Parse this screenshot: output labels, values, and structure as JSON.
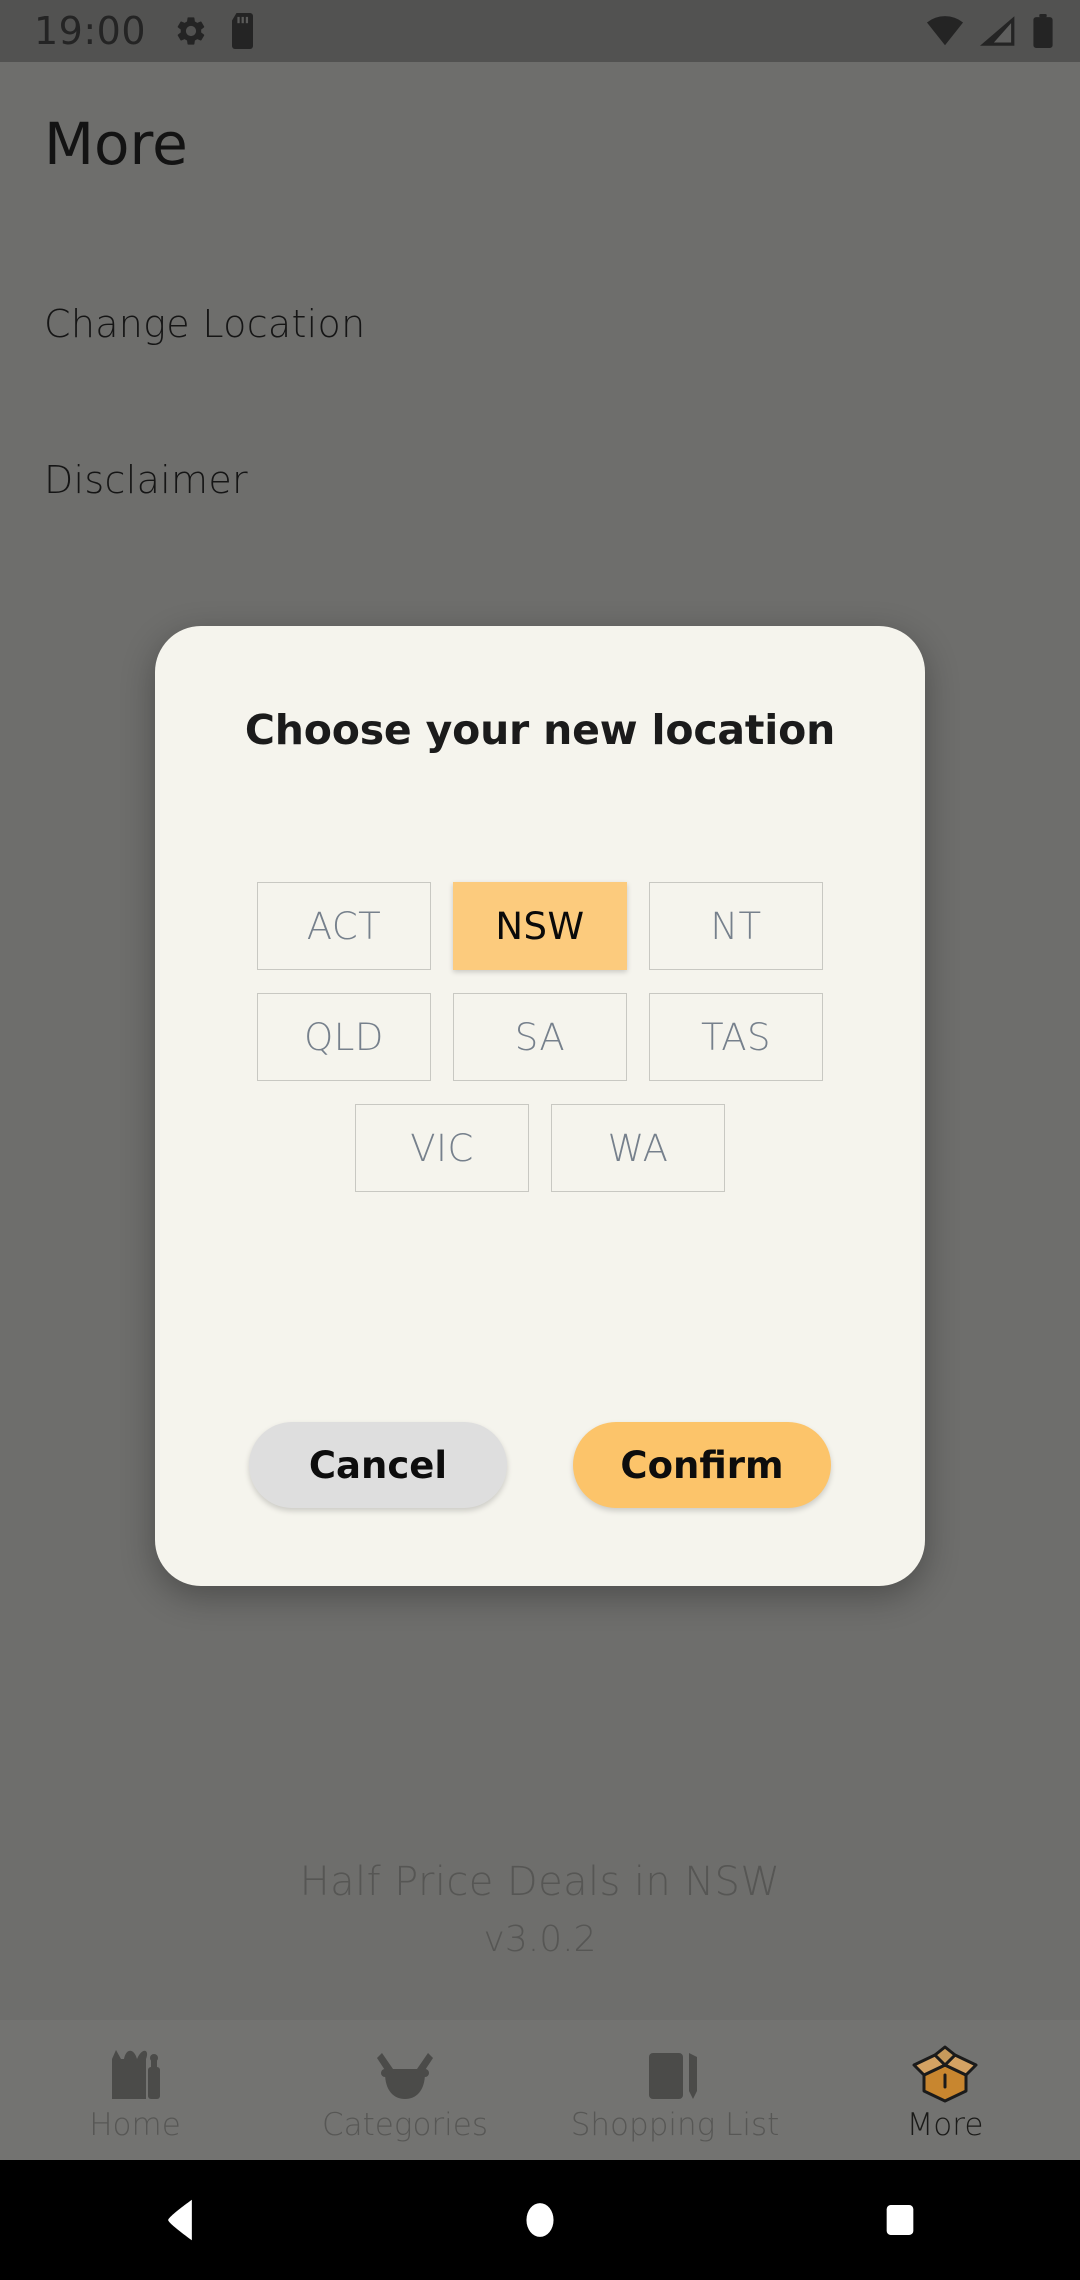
{
  "status_bar": {
    "time": "19:00",
    "left_icons": [
      "gear-icon",
      "sd-card-icon"
    ],
    "right_icons": [
      "wifi-icon",
      "cellular-signal-icon",
      "battery-icon"
    ],
    "background_color": "#525251"
  },
  "app": {
    "page_title": "More",
    "menu_items": [
      {
        "label": "Change Location"
      },
      {
        "label": "Disclaimer"
      }
    ],
    "footer": {
      "line1": "Half Price Deals in NSW",
      "line2": "v3.0.2"
    },
    "tabs": [
      {
        "label": "Home",
        "icon": "grocery-bag-icon",
        "active": false
      },
      {
        "label": "Categories",
        "icon": "mortar-pestle-icon",
        "active": false
      },
      {
        "label": "Shopping List",
        "icon": "notepad-pencil-icon",
        "active": false
      },
      {
        "label": "More",
        "icon": "open-box-icon",
        "active": true
      }
    ]
  },
  "dialog": {
    "title": "Choose your new location",
    "background_color": "#f5f4ed",
    "selected_state": "NSW",
    "state_rows": [
      [
        "ACT",
        "NSW",
        "NT"
      ],
      [
        "QLD",
        "SA",
        "TAS"
      ],
      [
        "VIC",
        "WA"
      ]
    ],
    "actions": {
      "cancel_label": "Cancel",
      "confirm_label": "Confirm",
      "cancel_color": "#dedede",
      "confirm_color": "#fcc46a"
    },
    "accent_color": "#fccb7d"
  },
  "nav_bar": {
    "buttons": [
      "back-icon",
      "home-icon",
      "recents-icon"
    ],
    "background_color": "#000000"
  }
}
